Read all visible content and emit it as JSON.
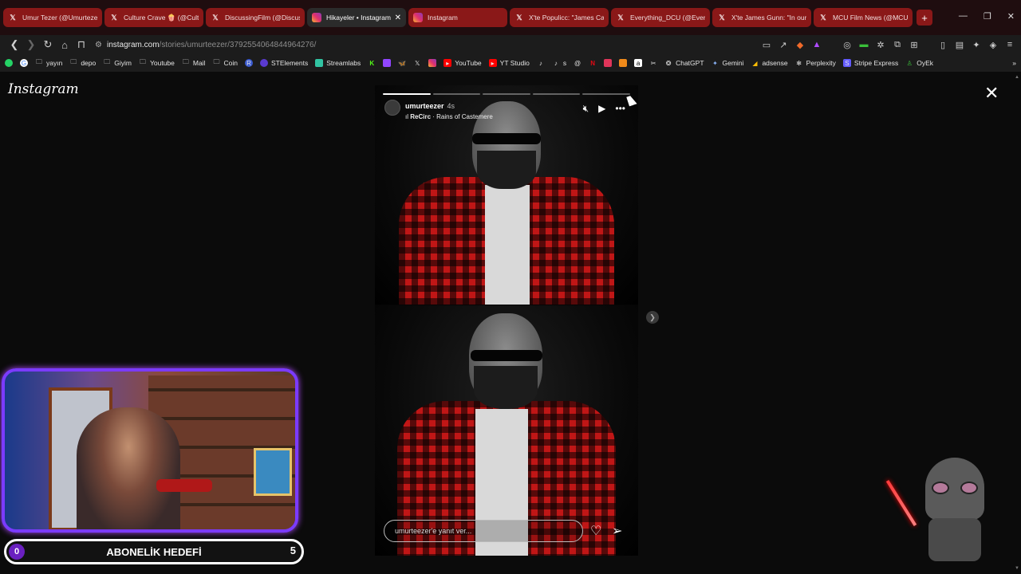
{
  "tabs": [
    {
      "title": "Umur Tezer (@Umurtezer)",
      "icon": "x-logo-icon"
    },
    {
      "title": "Culture Crave 🍿 (@Cultu",
      "icon": "x-logo-icon"
    },
    {
      "title": "DiscussingFilm (@Discuss",
      "icon": "x-logo-icon"
    },
    {
      "title": "Hikayeler • Instagram",
      "icon": "instagram-icon",
      "active": true
    },
    {
      "title": "Instagram",
      "icon": "instagram-icon"
    },
    {
      "title": "X'te Populicc: \"James Cam",
      "icon": "x-logo-icon"
    },
    {
      "title": "Everything_DCU (@Everyt",
      "icon": "x-logo-icon"
    },
    {
      "title": "X'te James Gunn: \"In our v",
      "icon": "x-logo-icon"
    },
    {
      "title": "MCU Film News (@MCUFi",
      "icon": "x-logo-icon"
    }
  ],
  "address": {
    "domain": "instagram.com",
    "path": "/stories/umurteezer/3792554064844964276/"
  },
  "bookmarks": [
    {
      "label": "",
      "icon": "whatsapp-icon"
    },
    {
      "label": "",
      "icon": "google-icon"
    },
    {
      "label": "yayın",
      "icon": "folder-icon"
    },
    {
      "label": "depo",
      "icon": "folder-icon"
    },
    {
      "label": "Giyim",
      "icon": "folder-icon"
    },
    {
      "label": "Youtube",
      "icon": "folder-icon"
    },
    {
      "label": "Mail",
      "icon": "folder-icon"
    },
    {
      "label": "Coin",
      "icon": "folder-icon"
    },
    {
      "label": "",
      "icon": "r-badge-icon"
    },
    {
      "label": "STElements",
      "icon": "stelements-icon"
    },
    {
      "label": "Streamlabs",
      "icon": "streamlabs-icon"
    },
    {
      "label": "",
      "icon": "kick-icon"
    },
    {
      "label": "",
      "icon": "twitch-icon"
    },
    {
      "label": "",
      "icon": "bluesky-icon"
    },
    {
      "label": "",
      "icon": "x-logo-icon"
    },
    {
      "label": "",
      "icon": "instagram-icon"
    },
    {
      "label": "YouTube",
      "icon": "youtube-icon"
    },
    {
      "label": "YT Studio",
      "icon": "yt-studio-icon"
    },
    {
      "label": "",
      "icon": "tiktok-icon"
    },
    {
      "label": "s",
      "icon": "tiktok-icon"
    },
    {
      "label": "",
      "icon": "threads-icon"
    },
    {
      "label": "",
      "icon": "netflix-icon"
    },
    {
      "label": "",
      "icon": "red-app-icon"
    },
    {
      "label": "",
      "icon": "orange-app-icon"
    },
    {
      "label": "",
      "icon": "amazon-icon"
    },
    {
      "label": "",
      "icon": "capcut-icon"
    },
    {
      "label": "ChatGPT",
      "icon": "chatgpt-icon"
    },
    {
      "label": "Gemini",
      "icon": "gemini-icon"
    },
    {
      "label": "adsense",
      "icon": "adsense-icon"
    },
    {
      "label": "Perplexity",
      "icon": "perplexity-icon"
    },
    {
      "label": "Stripe Express",
      "icon": "stripe-icon"
    },
    {
      "label": "OyEk",
      "icon": "oyek-icon"
    }
  ],
  "page": {
    "logo": "Instagram"
  },
  "story": {
    "username": "umurteezer",
    "age": "4s",
    "music_artist": "ReCirc",
    "music_song": "Rains of Castemere",
    "reply_placeholder": "umurteezer'e yanıt ver...",
    "segments_done": 1,
    "segments_total": 5
  },
  "overlay": {
    "goal_label": "ABONELİK HEDEFİ",
    "goal_current": "0",
    "goal_max": "5"
  },
  "colors": {
    "tab_bg": "#8a1818",
    "accent_purple": "#7b3bff",
    "shirt_red": "#c01616"
  }
}
